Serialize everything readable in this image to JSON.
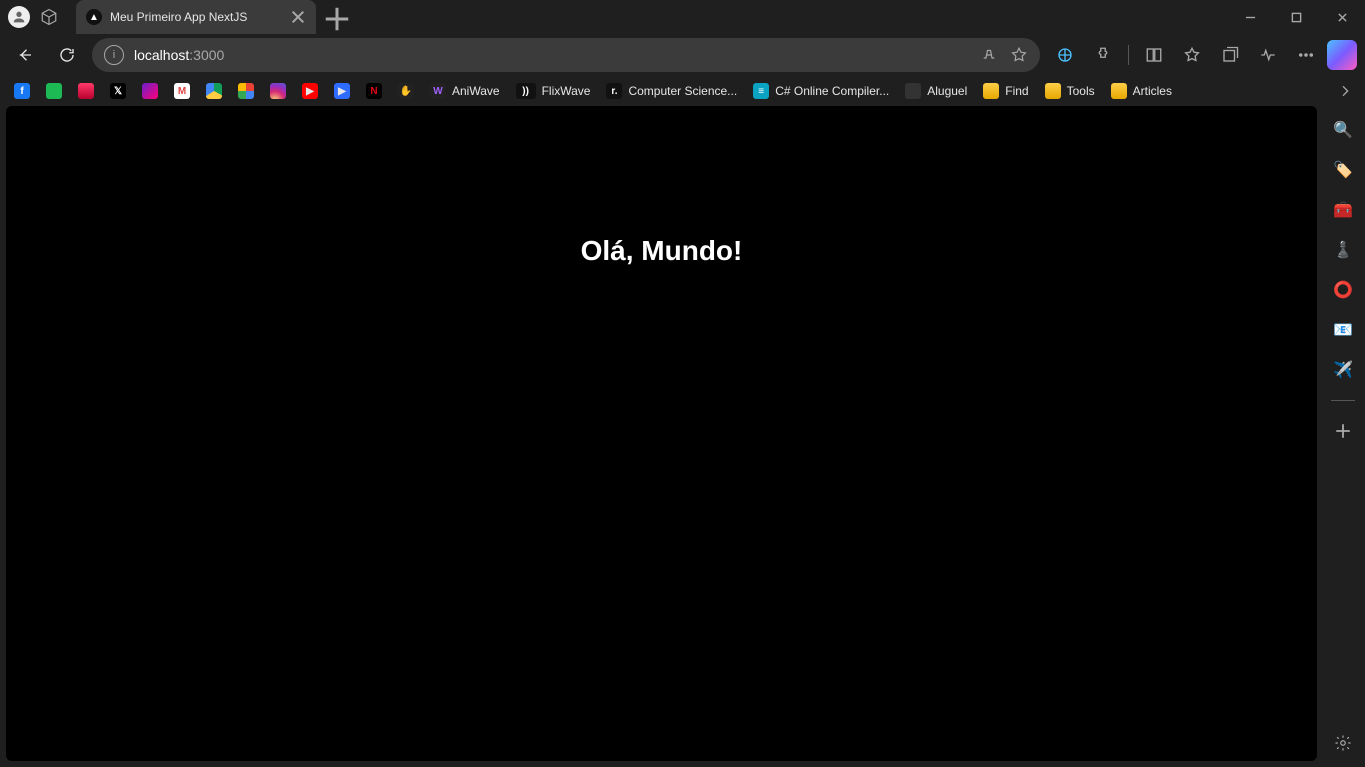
{
  "tab": {
    "title": "Meu Primeiro App NextJS",
    "favicon_label": "▲"
  },
  "address": {
    "host": "localhost",
    "port": ":3000"
  },
  "page": {
    "heading": "Olá, Mundo!"
  },
  "bookmarks": [
    {
      "cls": "fb",
      "glyph": "f",
      "label": ""
    },
    {
      "cls": "sp",
      "glyph": "",
      "label": ""
    },
    {
      "cls": "op",
      "glyph": "",
      "label": ""
    },
    {
      "cls": "x",
      "glyph": "𝕏",
      "label": ""
    },
    {
      "cls": "ym",
      "glyph": "",
      "label": ""
    },
    {
      "cls": "gm",
      "glyph": "M",
      "label": ""
    },
    {
      "cls": "gd",
      "glyph": "",
      "label": ""
    },
    {
      "cls": "gp",
      "glyph": "",
      "label": ""
    },
    {
      "cls": "ig",
      "glyph": "",
      "label": ""
    },
    {
      "cls": "yt",
      "glyph": "▶",
      "label": ""
    },
    {
      "cls": "pl",
      "glyph": "▶",
      "label": ""
    },
    {
      "cls": "nf",
      "glyph": "N",
      "label": ""
    },
    {
      "cls": "hc",
      "glyph": "✋",
      "label": ""
    },
    {
      "cls": "aw",
      "glyph": "W",
      "label": "AniWave"
    },
    {
      "cls": "fw",
      "glyph": "))",
      "label": "FlixWave"
    },
    {
      "cls": "cs",
      "glyph": "r.",
      "label": "Computer Science..."
    },
    {
      "cls": "cp",
      "glyph": "≡",
      "label": "C# Online Compiler..."
    },
    {
      "cls": "al",
      "glyph": "",
      "label": "Aluguel"
    },
    {
      "folder": true,
      "label": "Find"
    },
    {
      "folder": true,
      "label": "Tools"
    },
    {
      "folder": true,
      "label": "Articles"
    }
  ],
  "sidebar_icons": [
    {
      "name": "search",
      "glyph": "🔍"
    },
    {
      "name": "shopping",
      "glyph": "🏷️"
    },
    {
      "name": "toolbox",
      "glyph": "🧰"
    },
    {
      "name": "games",
      "glyph": "♟️"
    },
    {
      "name": "office",
      "glyph": "⭕"
    },
    {
      "name": "outlook",
      "glyph": "📧"
    },
    {
      "name": "send",
      "glyph": "✈️"
    }
  ]
}
